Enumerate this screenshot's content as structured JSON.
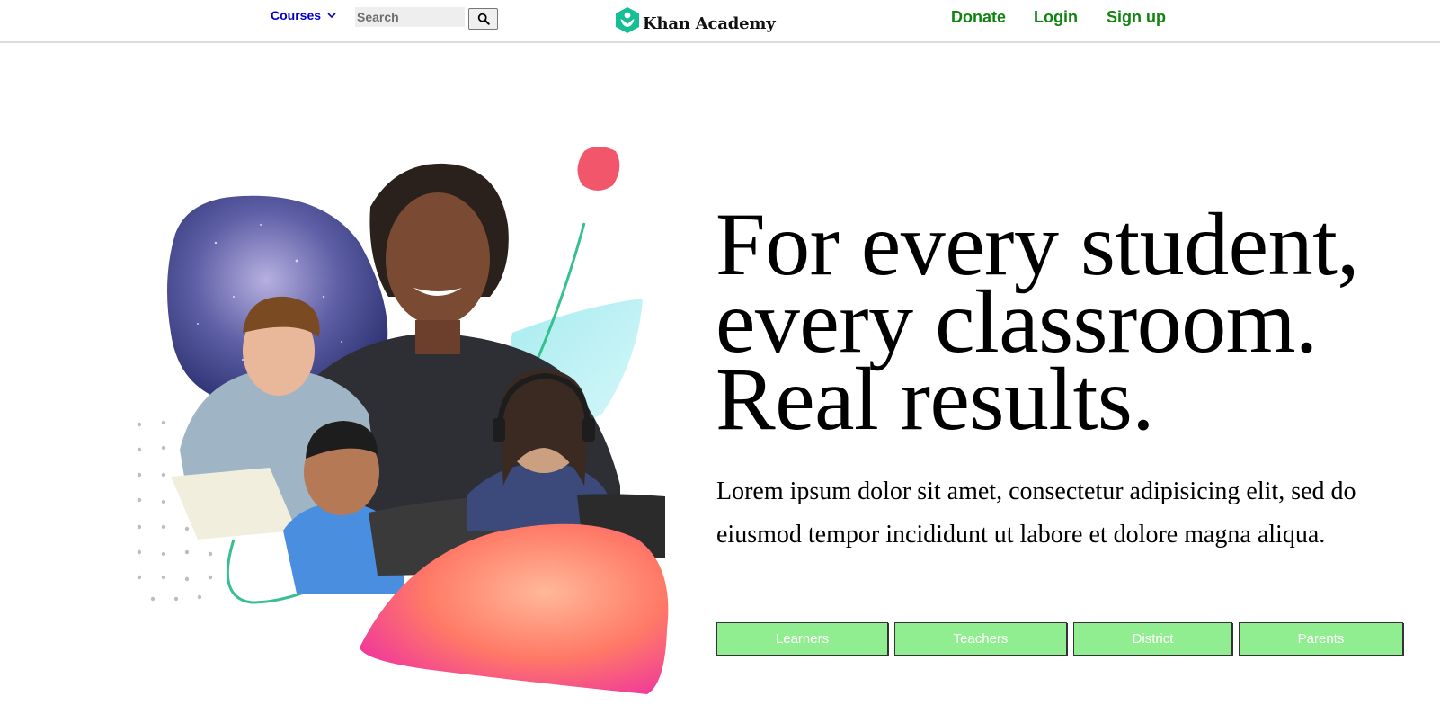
{
  "nav": {
    "courses_label": "Courses",
    "search_placeholder": "Search",
    "logo_text": "Khan Academy",
    "donate_label": "Donate",
    "login_label": "Login",
    "signup_label": "Sign up"
  },
  "hero": {
    "headline_lines": [
      "For every student,",
      "every classroom.",
      "Real results."
    ],
    "description": "Lorem ipsum dolor sit amet, consectetur adipisicing elit, sed do eiusmod tempor incididunt ut labore et dolore magna aliqua.",
    "buttons": [
      {
        "label": "Learners"
      },
      {
        "label": "Teachers"
      },
      {
        "label": "District"
      },
      {
        "label": "Parents"
      }
    ]
  },
  "colors": {
    "nav_link": "#118311",
    "courses_link": "#0000cc",
    "button_bg": "#90ee90",
    "logo_green": "#14bf96"
  },
  "icons": {
    "courses_chevron": "chevron-down-icon",
    "search": "search-icon",
    "logo": "khan-academy-logo-icon"
  }
}
